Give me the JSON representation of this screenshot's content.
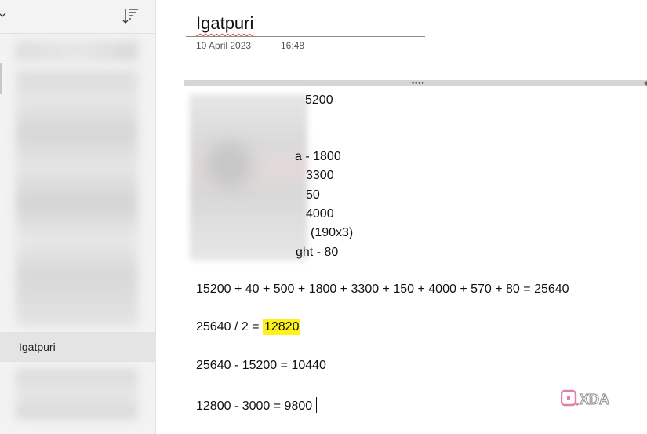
{
  "sidebar": {
    "selected_page": "Igatpuri"
  },
  "page": {
    "title": "Igatpuri",
    "date": "10 April 2023",
    "time": "16:48"
  },
  "note": {
    "partial_lines": [
      "5200",
      "a - 1800",
      "3300",
      "50",
      "4000",
      "(190x3)",
      "ght - 80"
    ],
    "sum_line": "15200 + 40 + 500 + 1800 + 3300 + 150 + 4000 + 570 + 80 = 25640",
    "half_prefix": "25640 / 2 = ",
    "half_value": "12820",
    "diff_line": "25640 - 15200 = 10440",
    "final_line": "12800 - 3000 = 9800"
  },
  "watermark": {
    "text": "XDA"
  },
  "colors": {
    "highlight": "#fff21a",
    "selected_item": "#e4e4e4",
    "sidebar_bg": "#f3f3f3"
  },
  "icons": {
    "collapse": "chevron-down-icon",
    "sort": "sort-icon",
    "watermark_logo": "xda-logo-icon"
  }
}
